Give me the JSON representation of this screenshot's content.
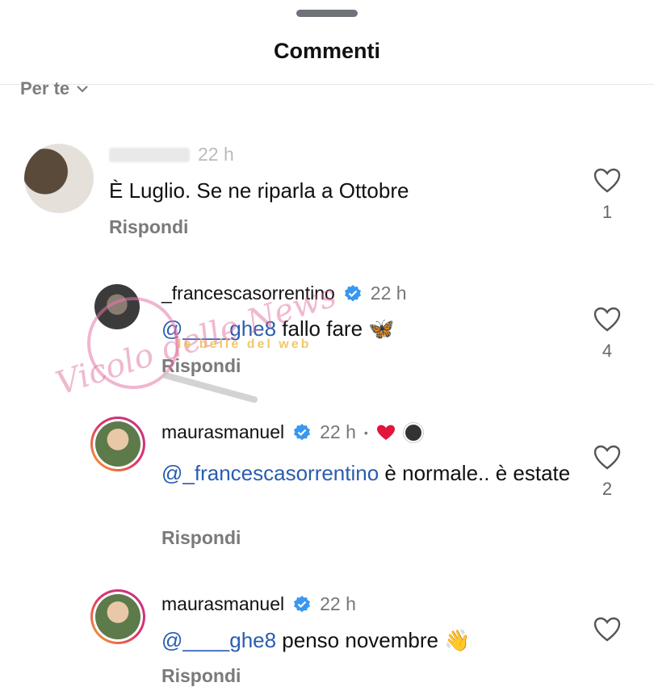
{
  "header": {
    "title": "Commenti",
    "sort_label": "Per te"
  },
  "comments": [
    {
      "username": "",
      "time": "22 h",
      "text": "È Luglio. Se ne riparla a Ottobre",
      "reply_label": "Rispondi",
      "likes": "1"
    },
    {
      "username": "_francescasorrentino",
      "time": "22 h",
      "mention": "@____ghe8",
      "text": " fallo fare 🦋",
      "reply_label": "Rispondi",
      "likes": "4"
    },
    {
      "username": "maurasmanuel",
      "time": "22 h",
      "dot": "•",
      "mention": "@_francescasorrentino",
      "text": " è normale.. è estate",
      "reply_label": "Rispondi",
      "likes": "2"
    },
    {
      "username": "maurasmanuel",
      "time": "22 h",
      "mention": "@____ghe8",
      "text": " penso novembre 👋",
      "reply_label": "Rispondi",
      "likes": ""
    }
  ],
  "watermark": {
    "main": "Vicolo delle News",
    "sub": "le belle del web"
  },
  "colors": {
    "mention": "#2a5db0",
    "verified": "#3897f0",
    "heart_red": "#e0163c"
  }
}
